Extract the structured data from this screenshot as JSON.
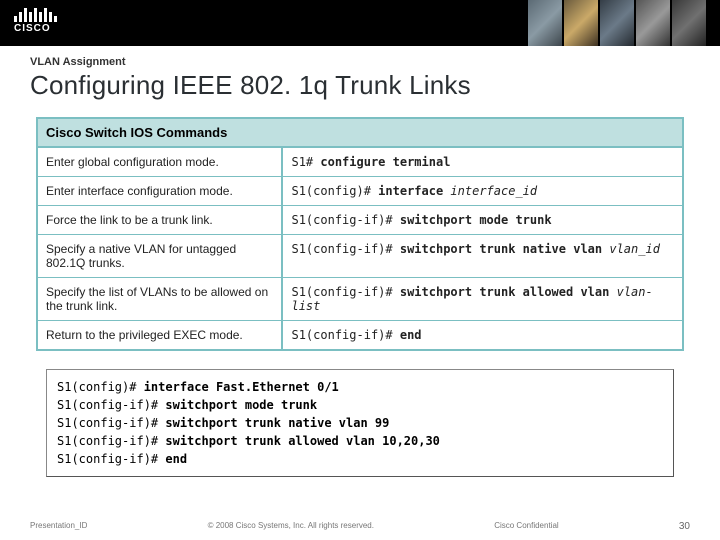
{
  "logo_text": "CISCO",
  "section_label": "VLAN Assignment",
  "title": "Configuring IEEE 802. 1q Trunk Links",
  "table": {
    "header": "Cisco Switch IOS Commands",
    "rows": [
      {
        "desc": "Enter global configuration mode.",
        "prompt": "S1# ",
        "cmd": "configure terminal",
        "var": ""
      },
      {
        "desc": "Enter interface configuration mode.",
        "prompt": "S1(config)# ",
        "cmd": "interface ",
        "var": "interface_id"
      },
      {
        "desc": "Force the link to be a trunk link.",
        "prompt": "S1(config-if)# ",
        "cmd": "switchport mode trunk",
        "var": ""
      },
      {
        "desc": "Specify a native VLAN for untagged 802.1Q trunks.",
        "prompt": "S1(config-if)# ",
        "cmd": "switchport trunk native vlan ",
        "var": "vlan_id"
      },
      {
        "desc": "Specify the list of VLANs to be allowed on the trunk link.",
        "prompt": "S1(config-if)# ",
        "cmd": "switchport trunk allowed vlan ",
        "var": "vlan-list"
      },
      {
        "desc": "Return to the privileged EXEC mode.",
        "prompt": "S1(config-if)# ",
        "cmd": "end",
        "var": ""
      }
    ]
  },
  "example": [
    {
      "prompt": "S1(config)# ",
      "cmd": "interface Fast.Ethernet 0/1"
    },
    {
      "prompt": "S1(config-if)# ",
      "cmd": "switchport mode trunk"
    },
    {
      "prompt": "S1(config-if)# ",
      "cmd": "switchport trunk native vlan 99"
    },
    {
      "prompt": "S1(config-if)# ",
      "cmd": "switchport trunk allowed vlan 10,20,30"
    },
    {
      "prompt": "S1(config-if)# ",
      "cmd": "end"
    }
  ],
  "footer": {
    "left": "Presentation_ID",
    "center": "© 2008 Cisco Systems, Inc. All rights reserved.",
    "right": "Cisco Confidential",
    "page": "30"
  }
}
